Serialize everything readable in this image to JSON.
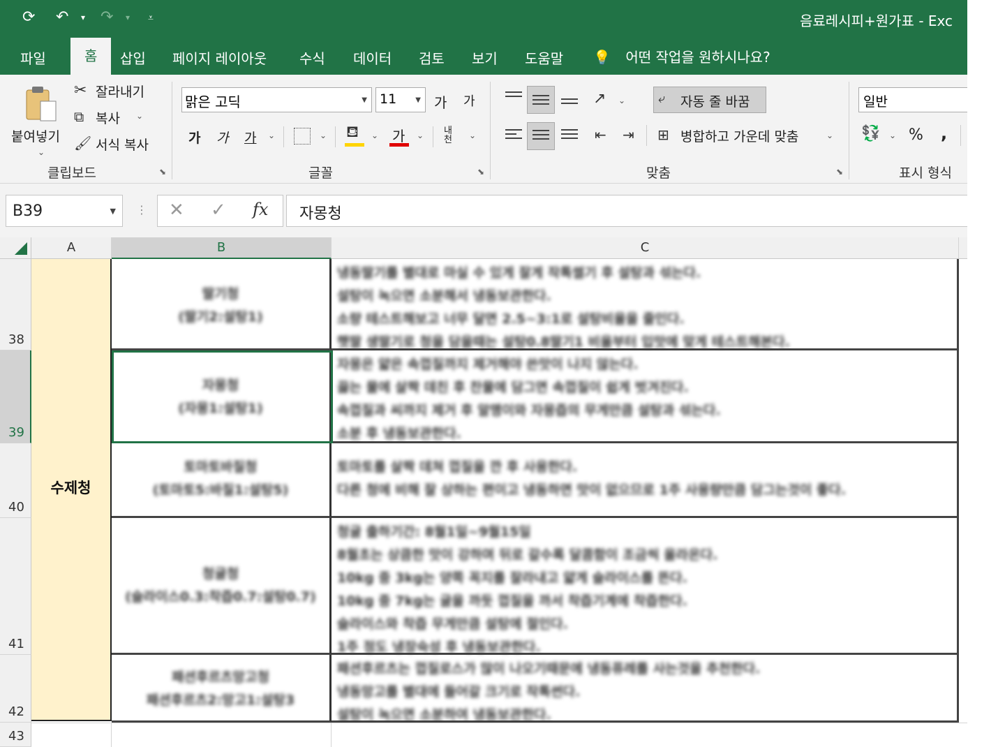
{
  "title_bar": {
    "document_title": "음료레시피+원가표  -  Exc",
    "qat_icons": [
      "autosave-icon",
      "undo-icon",
      "redo-icon",
      "customize-qat-icon"
    ]
  },
  "tabs": [
    {
      "label": "파일"
    },
    {
      "label": "홈",
      "active": true
    },
    {
      "label": "삽입"
    },
    {
      "label": "페이지 레이아웃"
    },
    {
      "label": "수식"
    },
    {
      "label": "데이터"
    },
    {
      "label": "검토"
    },
    {
      "label": "보기"
    },
    {
      "label": "도움말"
    }
  ],
  "tell_me": "어떤 작업을 원하시나요?",
  "clipboard": {
    "paste": "붙여넣기",
    "cut": "잘라내기",
    "copy": "복사",
    "format_painter": "서식 복사",
    "group_label": "클립보드"
  },
  "font": {
    "family": "맑은 고딕",
    "size": "11",
    "grow": "가",
    "shrink": "가",
    "bold": "가",
    "italic": "가",
    "underline": "가",
    "font_color_glyph": "가",
    "phonetic": "내천",
    "group_label": "글꼴",
    "fill_color": "#ffd400",
    "font_color": "#e00000"
  },
  "alignment": {
    "wrap_text": "자동 줄 바꿈",
    "merge_center": "병합하고 가운데 맞춤",
    "group_label": "맞춤"
  },
  "number": {
    "format": "일반",
    "percent": "%",
    "comma": ",",
    "group_label": "표시 형식"
  },
  "formula_bar": {
    "name_box": "B39",
    "content": "자몽청",
    "fx": "fx"
  },
  "columns": [
    "A",
    "B",
    "C"
  ],
  "rows": [
    {
      "num": "38",
      "name": "딸기청",
      "ratio": "(딸기2:설탕1)",
      "lines": [
        "냉동딸기를 별대로 마실 수 있게 잘게 작톡썰기 후 설탕과 섞는다.",
        "설탕이 녹으면 소분해서 냉동보관한다.",
        "소량 테스트해보고 너무 달면 2.5~3:1로 설탕비율을 줄인다.",
        "햇딸 생딸기로 청을 담을때는 설탕0.8딸기1 비율부터 입맛에 맞게 테스트해본다."
      ]
    },
    {
      "num": "39",
      "name": "자몽청",
      "ratio": "(자몽1:설탕1)",
      "lines": [
        "자몽은 얇은 속껍질까지 제거해야 쓴맛이 나지 않는다.",
        "끓는 물에 살짝 데친 후 찬물에 담그면 속껍질이 쉽게 벗겨진다.",
        "속껍질과 씨까지 제거 후 알맹이와 자몽즙의 무게만큼 설탕과 섞는다.",
        "소분 후 냉동보관한다."
      ]
    },
    {
      "num": "40",
      "name": "토마토바질청",
      "ratio": "(토마토5:바질1:설탕5)",
      "lines": [
        "토마토를 살짝 데쳐 껍질을 깐 후 사용한다.",
        "다른 청에 비해 잘 상하는 편이고 냉동하면 맛이 없으므로 1주 사용량만큼 담그는것이 좋다."
      ]
    },
    {
      "num": "41",
      "name": "청귤청",
      "ratio": "(슬라이스0.3:착즙0.7:설탕0.7)",
      "lines": [
        "청귤 출하기간: 8월1일~9월15일",
        "8월초는 상큼한 맛이 강하며 뒤로 갈수록 달콤함이 조금씩 올라온다.",
        "10kg 중 3kg는 양쪽 꼭지를 잘라내고 얇게 슬라이스를 뜬다.",
        "10kg 중 7kg는 귤을 까듯 껍질을 까서 착즙기계에 착즙한다.",
        "슬라이스와 착즙 무게만큼 설탕에 절인다.",
        "1주 정도 냉장숙성 후 냉동보관한다."
      ]
    },
    {
      "num": "42",
      "name": "패션후르츠망고청",
      "ratio": "패션후르츠2:망고1:설탕3",
      "lines": [
        "패션후르츠는 껍질로스가 많이 나오기때문에 냉동퓨레를 사는것을 추천한다.",
        "냉동망고를 별대에 들어갈 크기로 작톡썬다.",
        "설탕이 녹으면 소분하여 냉동보관한다."
      ]
    },
    {
      "num": "43"
    }
  ],
  "category_cell": "수제청"
}
